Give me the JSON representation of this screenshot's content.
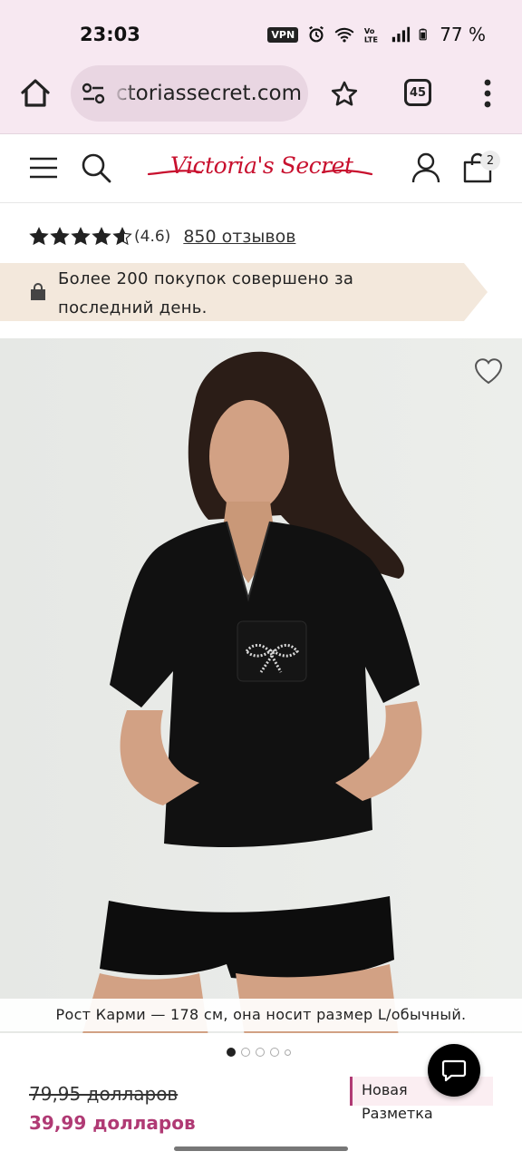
{
  "status_bar": {
    "time": "23:03",
    "vpn_label": "VPN",
    "battery": "77 %",
    "icons": [
      "vpn-icon",
      "alarm-icon",
      "wifi-icon",
      "volte-icon",
      "signal-icon",
      "battery-icon"
    ]
  },
  "browser": {
    "url": "ctoriassecret.com",
    "tab_count": "45",
    "icons": [
      "home-icon",
      "site-settings-icon",
      "bookmark-star-icon",
      "tabs-icon",
      "overflow-menu-icon"
    ]
  },
  "header": {
    "logo_text": "Victoria's Secret",
    "bag_count": "2",
    "icons": [
      "hamburger-menu-icon",
      "search-icon",
      "account-icon",
      "shopping-bag-icon"
    ]
  },
  "rating": {
    "stars": 4.6,
    "value_label": "(4.6)",
    "reviews_label": "850 отзывов"
  },
  "promo": {
    "text": "Более 200 покупок совершено за последний день."
  },
  "product": {
    "caption": "Рост Карми — 178 см, она носит размер L/обычный.",
    "carousel_count": 5,
    "carousel_active": 0
  },
  "price": {
    "old": "79,95 долларов",
    "new": "39,99 долларов"
  },
  "tag": {
    "line1": "Новая",
    "line2": "Разметка"
  },
  "colors": {
    "browser_bg": "#f7e8f1",
    "brand_red": "#c8102e",
    "sale_price": "#b03a74",
    "promo_bg": "#f3e8dc"
  }
}
